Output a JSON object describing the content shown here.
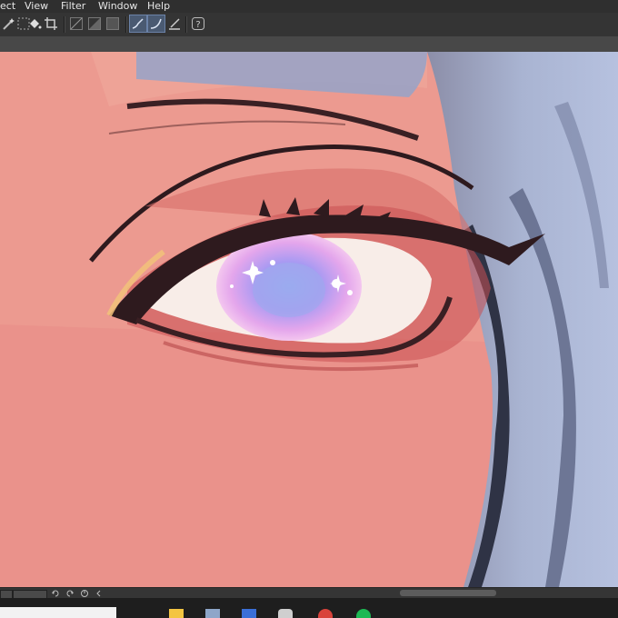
{
  "menubar": {
    "items": [
      {
        "label": "ect"
      },
      {
        "label": "View"
      },
      {
        "label": "Filter"
      },
      {
        "label": "Window"
      },
      {
        "label": "Help"
      }
    ]
  },
  "toolbar": {
    "icons": [
      "magic-wand-icon",
      "selection-dots-icon",
      "fill-bucket-icon",
      "crop-icon",
      "ruler-line-icon",
      "ruler-curve-icon",
      "ruler-shape-icon",
      "pen-stroke-icon",
      "pen-curve-icon",
      "pen-tilt-icon",
      "help-question-icon"
    ]
  },
  "statusbar": {
    "icons": [
      "rotate-left-icon",
      "rotate-right-icon",
      "reset-rotation-icon",
      "scroll-left-icon"
    ]
  },
  "taskbar": {
    "icons": [
      "explorer-icon",
      "files-icon",
      "app-icon",
      "clip-studio-icon",
      "chrome-icon",
      "spotify-icon"
    ]
  },
  "colors": {
    "menubar_bg": "#2f2f2f",
    "toolbar_bg": "#343434",
    "active_tool": "#4a5a72",
    "skin": "#ec9a90",
    "hair": "#9aa7c8",
    "iris": "#b49af0",
    "eyeliner": "#2e1a1e"
  }
}
